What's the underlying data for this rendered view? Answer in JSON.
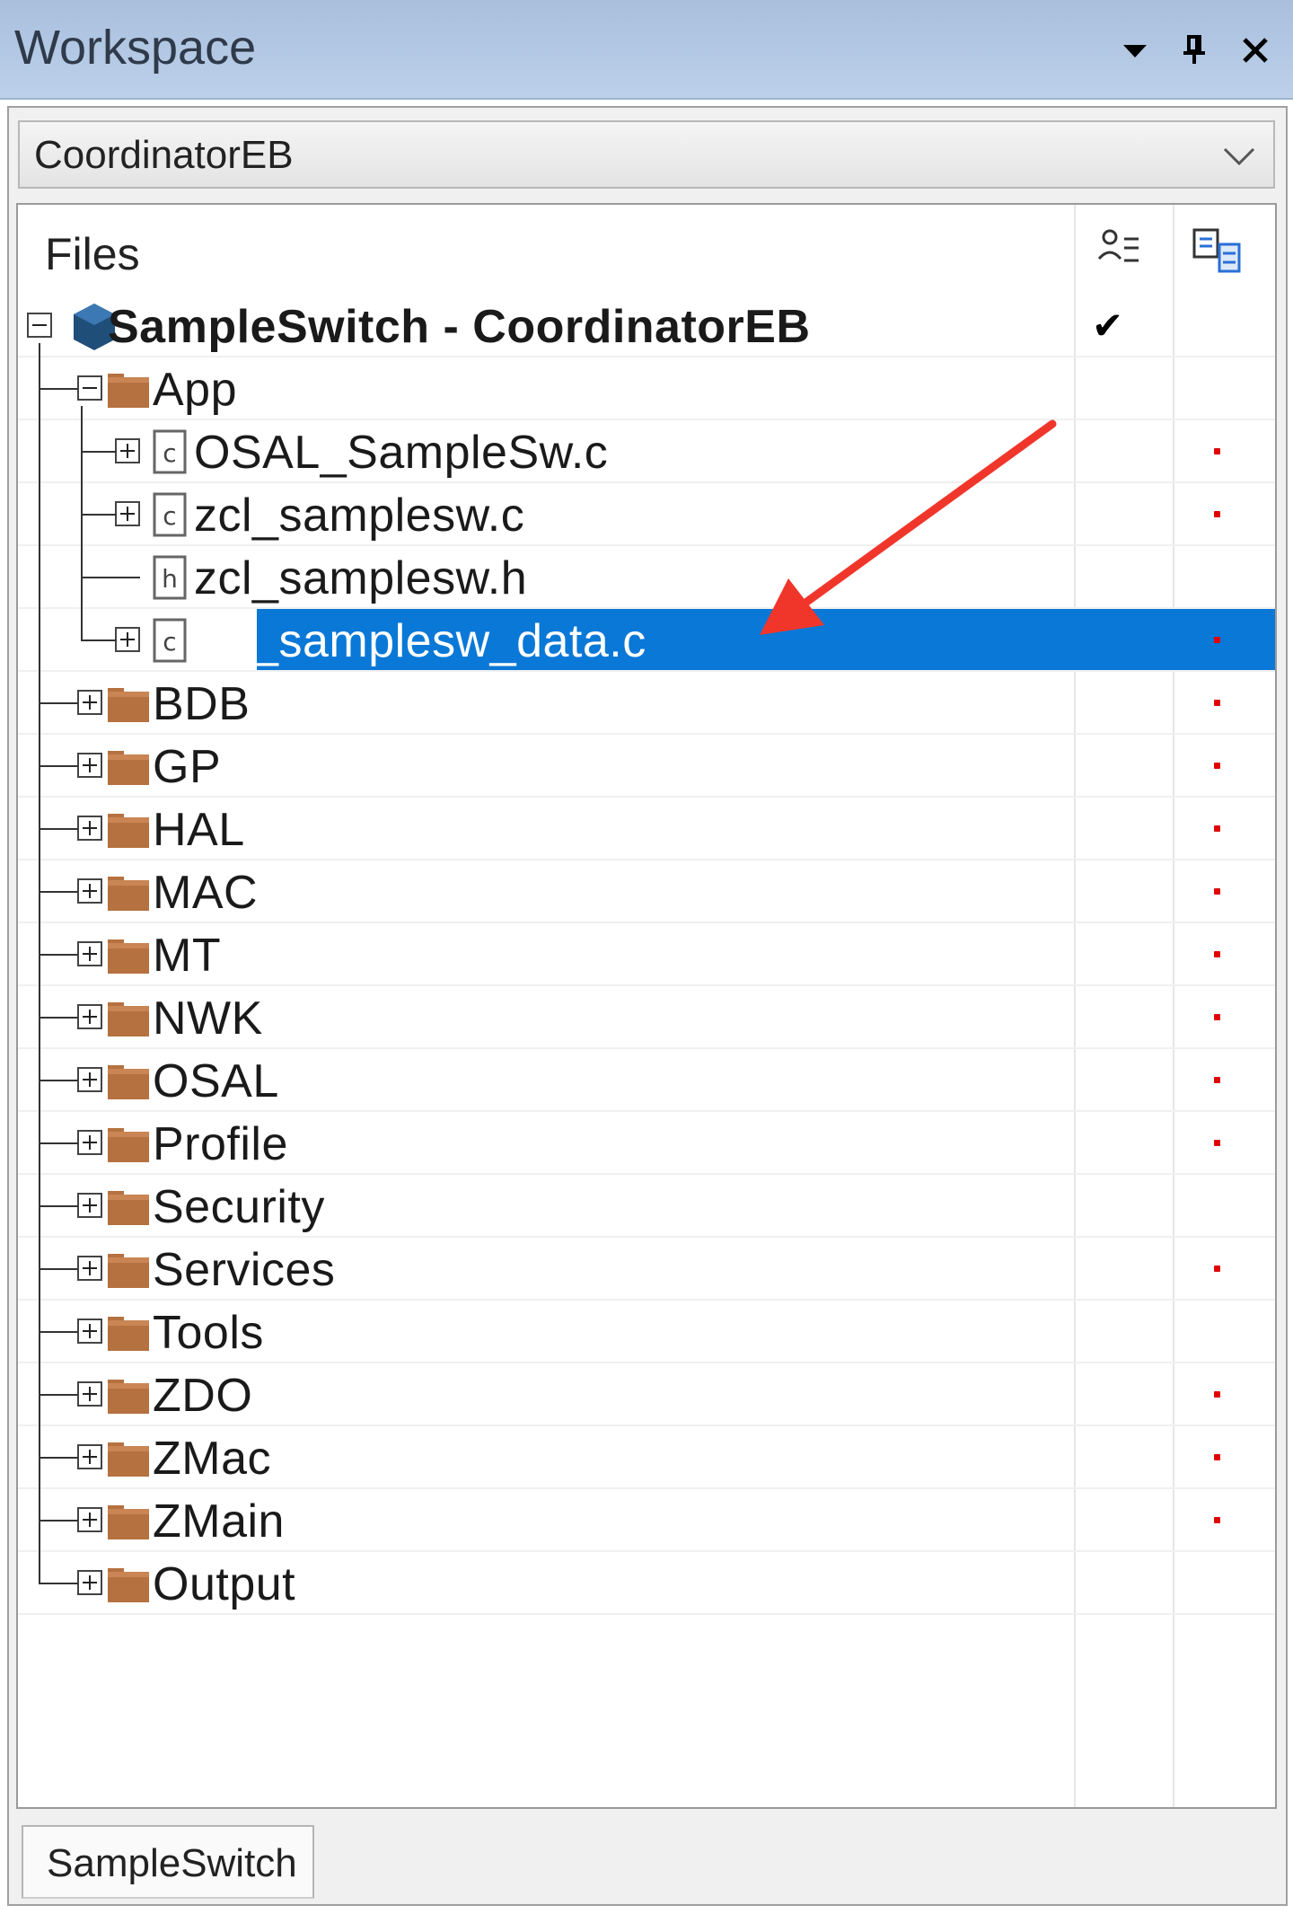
{
  "window": {
    "title": "Workspace"
  },
  "config": {
    "selected": "CoordinatorEB"
  },
  "tree_header": {
    "files_label": "Files"
  },
  "tree": [
    {
      "label": "SampleSwitch - CoordinatorEB",
      "level": 0,
      "type": "project",
      "expander": "minus",
      "checked": true,
      "dot": false,
      "bold": true
    },
    {
      "label": "App",
      "level": 1,
      "type": "folder",
      "expander": "minus",
      "dot": false
    },
    {
      "label": "OSAL_SampleSw.c",
      "level": 2,
      "type": "file-c",
      "expander": "plus",
      "dot": true
    },
    {
      "label": "zcl_samplesw.c",
      "level": 2,
      "type": "file-c",
      "expander": "plus",
      "dot": true
    },
    {
      "label": "zcl_samplesw.h",
      "level": 2,
      "type": "file-h",
      "expander": "none",
      "dot": false
    },
    {
      "label": "zcl_samplesw_data.c",
      "level": 2,
      "type": "file-c",
      "expander": "plus",
      "dot": true,
      "selected": true
    },
    {
      "label": "BDB",
      "level": 1,
      "type": "folder",
      "expander": "plus",
      "dot": true
    },
    {
      "label": "GP",
      "level": 1,
      "type": "folder",
      "expander": "plus",
      "dot": true
    },
    {
      "label": "HAL",
      "level": 1,
      "type": "folder",
      "expander": "plus",
      "dot": true
    },
    {
      "label": "MAC",
      "level": 1,
      "type": "folder",
      "expander": "plus",
      "dot": true
    },
    {
      "label": "MT",
      "level": 1,
      "type": "folder",
      "expander": "plus",
      "dot": true
    },
    {
      "label": "NWK",
      "level": 1,
      "type": "folder",
      "expander": "plus",
      "dot": true
    },
    {
      "label": "OSAL",
      "level": 1,
      "type": "folder",
      "expander": "plus",
      "dot": true
    },
    {
      "label": "Profile",
      "level": 1,
      "type": "folder",
      "expander": "plus",
      "dot": true
    },
    {
      "label": "Security",
      "level": 1,
      "type": "folder",
      "expander": "plus",
      "dot": false
    },
    {
      "label": "Services",
      "level": 1,
      "type": "folder",
      "expander": "plus",
      "dot": true
    },
    {
      "label": "Tools",
      "level": 1,
      "type": "folder",
      "expander": "plus",
      "dot": false
    },
    {
      "label": "ZDO",
      "level": 1,
      "type": "folder",
      "expander": "plus",
      "dot": true
    },
    {
      "label": "ZMac",
      "level": 1,
      "type": "folder",
      "expander": "plus",
      "dot": true
    },
    {
      "label": "ZMain",
      "level": 1,
      "type": "folder",
      "expander": "plus",
      "dot": true
    },
    {
      "label": "Output",
      "level": 1,
      "type": "folder",
      "expander": "plus",
      "dot": false
    }
  ],
  "bottom_tab": {
    "label": "SampleSwitch"
  },
  "colors": {
    "selection": "#0a78d7",
    "folder": "#b5713f",
    "project": "#1f4e79",
    "dot": "#e00000",
    "arrow": "#f0362b"
  },
  "icons": [
    "dropdown-triangle-icon",
    "pin-icon",
    "close-icon",
    "chevron-down-icon",
    "column-options-icon",
    "column-build-icon",
    "project-cube-icon",
    "folder-icon",
    "c-file-icon",
    "h-file-icon"
  ]
}
